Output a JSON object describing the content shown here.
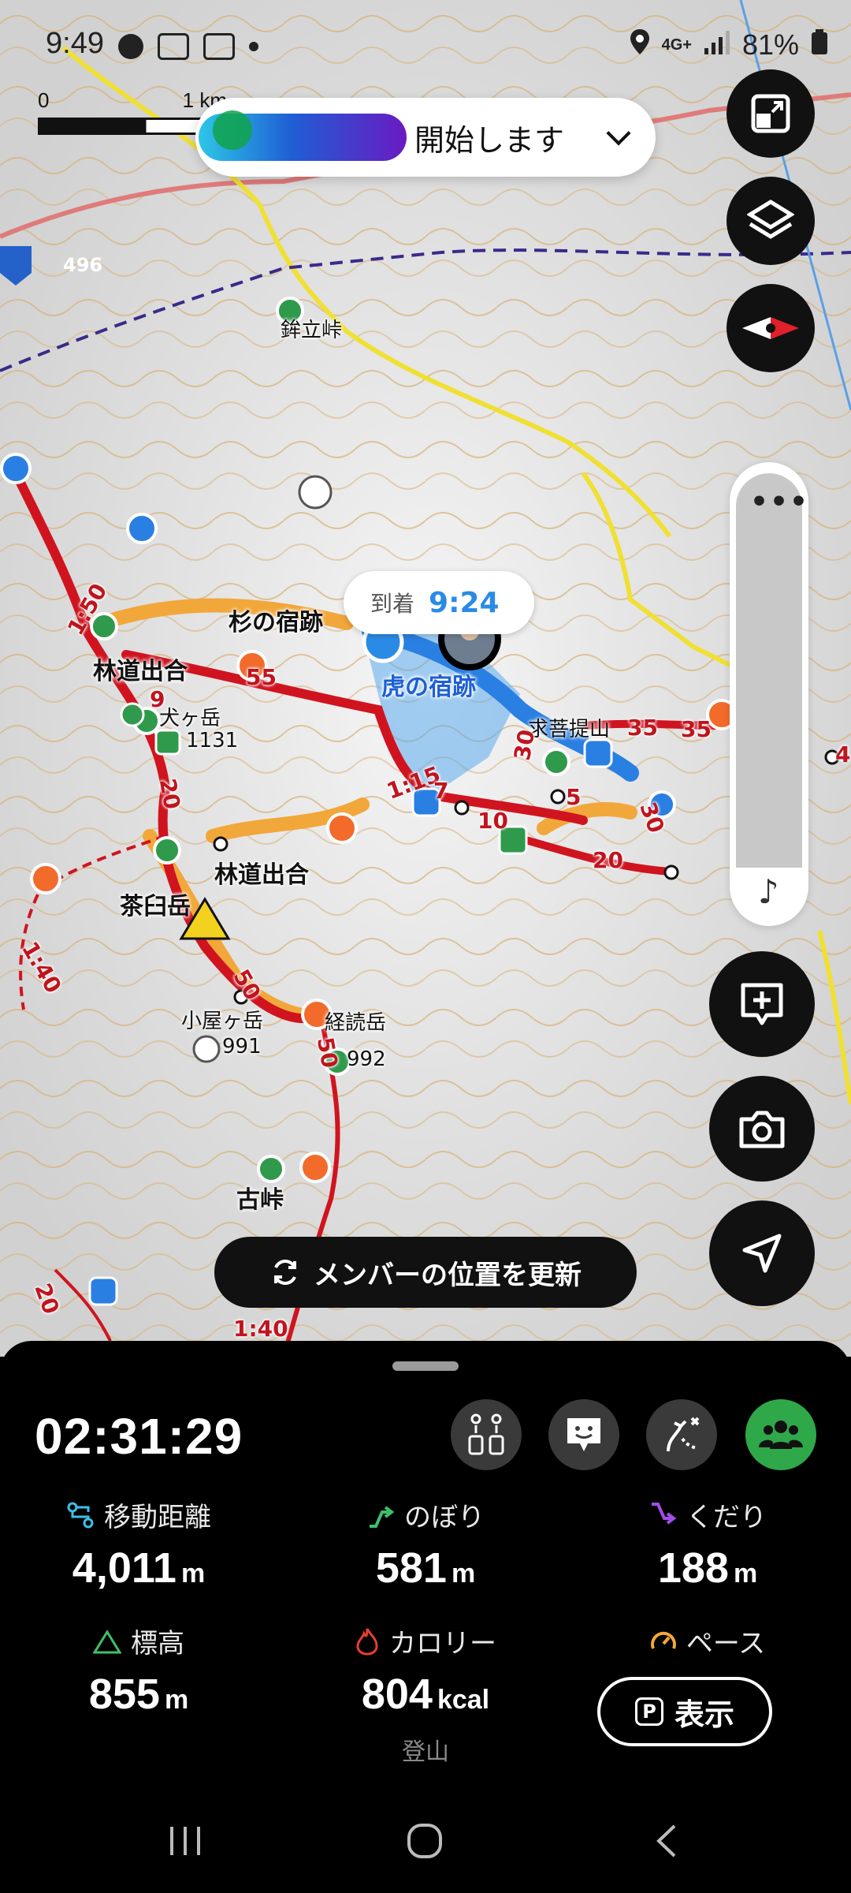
{
  "status_bar": {
    "time": "9:49",
    "network": "4G+",
    "battery": "81%"
  },
  "scale": {
    "zero": "0",
    "one_km": "1 km"
  },
  "banner": {
    "text": "開始します"
  },
  "map": {
    "road_number": "496",
    "labels": {
      "pass1": "鉾立峠",
      "sugi": "杉の宿跡",
      "tora": "虎の宿跡",
      "rindo1": "林道出合",
      "rindo2": "林道出合",
      "inugatake": "犬ヶ岳",
      "inu_elev": "1131",
      "chausu": "茶臼岳",
      "koya": "小屋ヶ岳",
      "koya_elev": "991",
      "yomi": "経読岳",
      "yomi_elev": "992",
      "kotoge": "古峠",
      "bodai": "求菩提山"
    },
    "times": [
      "1:50",
      "55",
      "9",
      "20",
      "1:15",
      "7",
      "10",
      "5",
      "30",
      "35",
      "35",
      "30",
      "20",
      "50",
      "50",
      "1:40",
      "20",
      "1:40",
      "4"
    ]
  },
  "arrival": {
    "label": "到着",
    "time": "9:24"
  },
  "update_button": {
    "label": "メンバーの位置を更新"
  },
  "sheet": {
    "timer": "02:31:29",
    "stats": [
      {
        "label": "移動距離",
        "value": "4,011",
        "unit": "m"
      },
      {
        "label": "のぼり",
        "value": "581",
        "unit": "m"
      },
      {
        "label": "くだり",
        "value": "188",
        "unit": "m"
      },
      {
        "label": "標高",
        "value": "855",
        "unit": "m"
      },
      {
        "label": "カロリー",
        "value": "804",
        "unit": "kcal"
      },
      {
        "label": "ペース",
        "value": "",
        "unit": ""
      }
    ],
    "pace_button": "表示",
    "activity": "登山"
  },
  "colors": {
    "route_red": "#d0141f",
    "route_orange": "#f2a73a",
    "track_blue": "#2a7fe2",
    "sheet_bg": "#000000",
    "accent_green": "#2fa84a"
  }
}
